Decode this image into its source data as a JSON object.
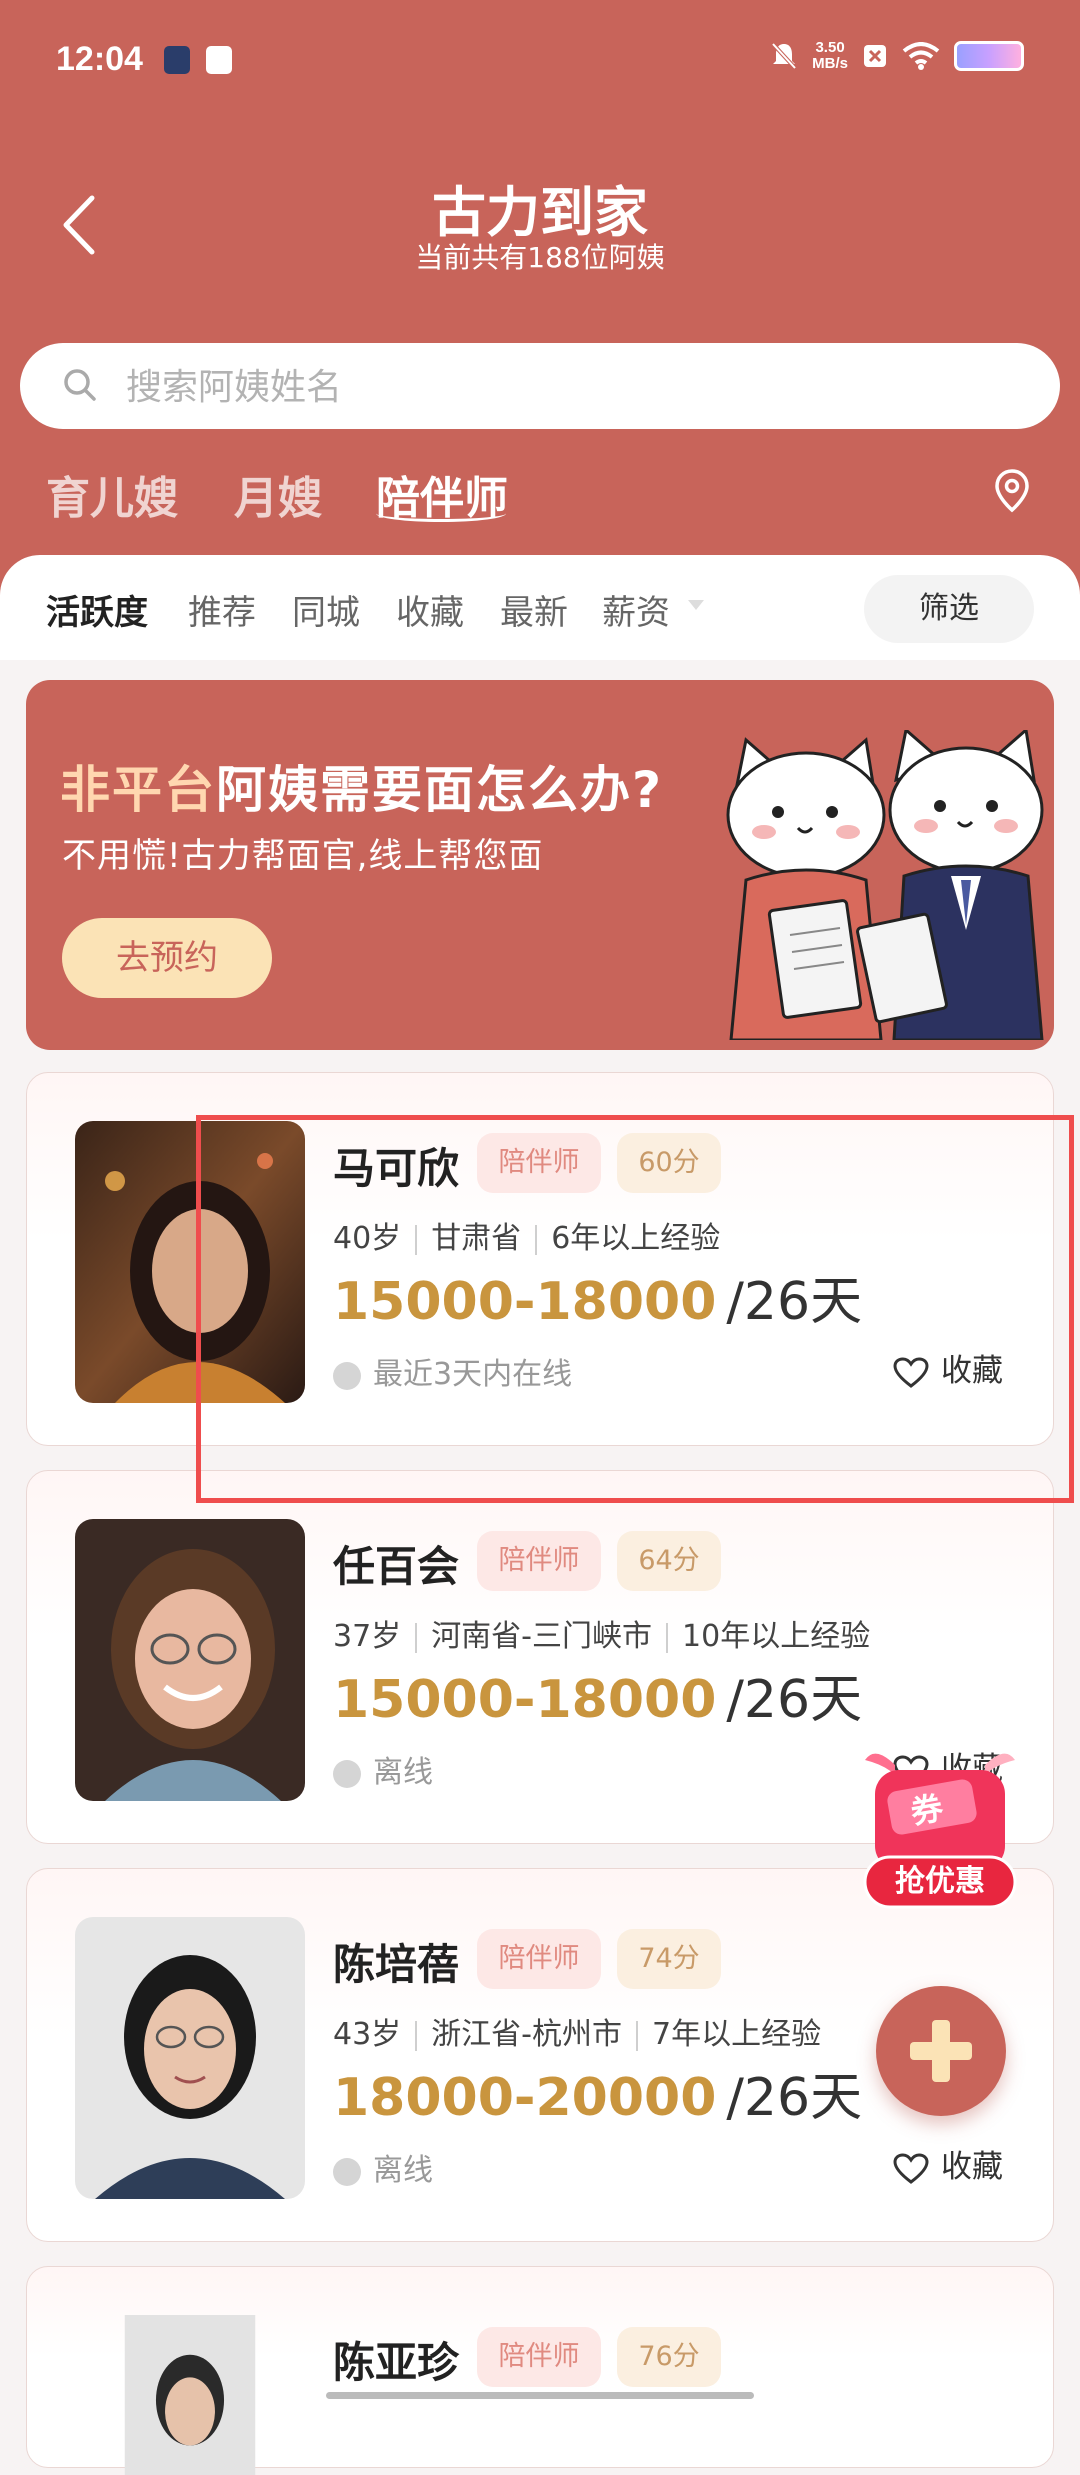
{
  "status_bar": {
    "time": "12:04",
    "net_speed_value": "3.50",
    "net_speed_unit": "MB/s"
  },
  "header": {
    "title": "古力到家",
    "subtitle": "当前共有188位阿姨"
  },
  "search": {
    "placeholder": "搜索阿姨姓名"
  },
  "category_tabs": [
    "育儿嫂",
    "月嫂",
    "陪伴师"
  ],
  "active_category": "陪伴师",
  "sort_tabs": [
    "活跃度",
    "推荐",
    "同城",
    "收藏",
    "最新",
    "薪资"
  ],
  "active_sort": "活跃度",
  "filter_label": "筛选",
  "banner": {
    "title_highlight": "非平台",
    "title_rest": "阿姨需要面怎么办?",
    "subtitle": "不用慌!古力帮面官,线上帮您面",
    "button": "去预约"
  },
  "caregivers": [
    {
      "name": "马可欣",
      "role": "陪伴师",
      "score": "60分",
      "age": "40岁",
      "location": "甘肃省",
      "experience": "6年以上经验",
      "salary": "15000-18000",
      "period": "/26天",
      "status": "最近3天内在线",
      "favorite": "收藏"
    },
    {
      "name": "任百会",
      "role": "陪伴师",
      "score": "64分",
      "age": "37岁",
      "location": "河南省-三门峡市",
      "experience": "10年以上经验",
      "salary": "15000-18000",
      "period": "/26天",
      "status": "离线",
      "favorite": "收藏"
    },
    {
      "name": "陈培蓓",
      "role": "陪伴师",
      "score": "74分",
      "age": "43岁",
      "location": "浙江省-杭州市",
      "experience": "7年以上经验",
      "salary": "18000-20000",
      "period": "/26天",
      "status": "离线",
      "favorite": "收藏"
    },
    {
      "name": "陈亚珍",
      "role": "陪伴师",
      "score": "76分"
    }
  ],
  "coupon": {
    "badge": "券",
    "label": "抢优惠"
  },
  "colors": {
    "primary": "#c8645a",
    "salary": "#c9953e",
    "highlight": "#ef4d4d"
  }
}
